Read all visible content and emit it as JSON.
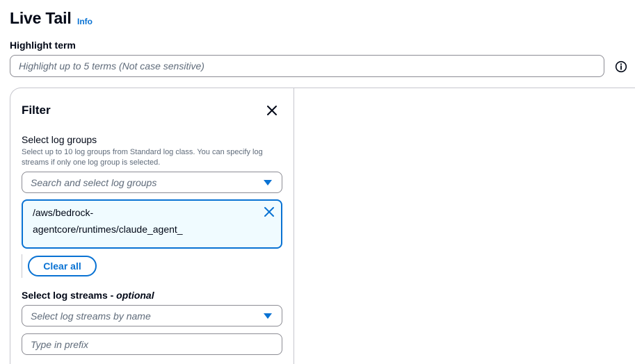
{
  "header": {
    "title": "Live Tail",
    "info_label": "Info"
  },
  "highlight": {
    "label": "Highlight term",
    "placeholder": "Highlight up to 5 terms (Not case sensitive)",
    "value": ""
  },
  "filter": {
    "title": "Filter",
    "log_groups": {
      "label": "Select log groups",
      "description": "Select up to 10 log groups from Standard log class. You can specify log streams if only one log group is selected.",
      "placeholder": "Search and select log groups",
      "selected": [
        {
          "name": "/aws/bedrock-agentcore/runtimes/claude_agent_"
        }
      ],
      "clear_all_label": "Clear all"
    },
    "log_streams": {
      "label": "Select log streams - ",
      "label_optional": "optional",
      "placeholder": "Select log streams by name",
      "prefix_placeholder": "Type in prefix",
      "prefix_value": ""
    }
  },
  "colors": {
    "accent": "#0972d3",
    "text": "#000716",
    "muted": "#5f6b7a",
    "border": "#8c8c94",
    "token_bg": "#f0fbff"
  },
  "icons": {
    "info": "info-circle-icon",
    "close": "close-icon",
    "caret": "caret-down-icon",
    "remove": "remove-token-icon"
  }
}
